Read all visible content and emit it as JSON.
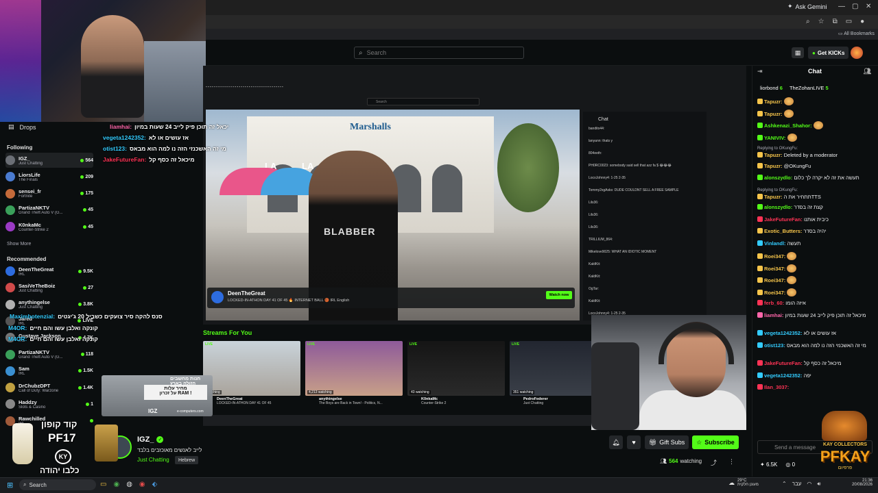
{
  "browser": {
    "ask_gemini": "Ask Gemini",
    "all_bookmarks": "All Bookmarks"
  },
  "header": {
    "search_placeholder": "Search",
    "get_kicks": "Get KICKs"
  },
  "sidebar": {
    "drops": "Drops",
    "following_title": "Following",
    "following": [
      {
        "name": "IGZ_",
        "category": "Just Chatting",
        "viewers": "564",
        "color": "#6b6f76"
      },
      {
        "name": "LiorsLife",
        "category": "The Finals",
        "viewers": "209",
        "color": "#4a7bd0"
      },
      {
        "name": "sensei_fr",
        "category": "Fortnite",
        "viewers": "175",
        "color": "#c46a3a"
      },
      {
        "name": "PartizaNKTV",
        "category": "Grand Theft Auto V (G...",
        "viewers": "45",
        "color": "#3aa05a"
      },
      {
        "name": "K0nkaMc",
        "category": "Counter-Strike 2",
        "viewers": "45",
        "color": "#9a3ac4"
      }
    ],
    "show_more": "Show More",
    "recommended_title": "Recommended",
    "recommended": [
      {
        "name": "DeenTheGreat",
        "category": "IRL",
        "viewers": "9.5K",
        "color": "#2d6cdf"
      },
      {
        "name": "SasiVeTheBoiz",
        "category": "Just Chatting",
        "viewers": "27",
        "color": "#d04a4a"
      },
      {
        "name": "anythingelse",
        "category": "Just Chatting",
        "viewers": "3.8K",
        "color": "#b0b0b0"
      },
      {
        "name": "Jared",
        "category": "IRL",
        "viewers": "LIVE",
        "color": "#555"
      },
      {
        "name": "Gustave Jackson",
        "category": "IRL",
        "viewers": "4.7K",
        "color": "#777"
      },
      {
        "name": "PartizaNKTV",
        "category": "Grand Theft Auto V (G...",
        "viewers": "118",
        "color": "#3aa05a"
      },
      {
        "name": "Sam",
        "category": "IRL",
        "viewers": "1.5K",
        "color": "#3a8fd0"
      },
      {
        "name": "DrChubzDPT",
        "category": "Call of Duty: Warzone",
        "viewers": "1.4K",
        "color": "#c0a040"
      },
      {
        "name": "Haddzy",
        "category": "Slots & Casino",
        "viewers": "1",
        "color": "#888"
      },
      {
        "name": "Rawchilled",
        "category": "IRL",
        "viewers": "",
        "color": "#a05a3a"
      }
    ]
  },
  "overlay_chat": [
    {
      "user": "liamhai:",
      "text": "יכאל זה תוכן פיק לייב 24 שעות במיון",
      "color": "#ff66aa"
    },
    {
      "user": "vegeta1242352:",
      "text": "אז עושים או לא",
      "color": "#33ccff"
    },
    {
      "user": "otist123:",
      "text": "מי זה האשכנזי הזה נו למה הוא מבאס",
      "color": "#33ccff"
    },
    {
      "user": "JakeFutureFan:",
      "text": "מיכאל זה כסף קל",
      "color": "#ff3355"
    },
    {
      "user": "Maximbotenzial:",
      "text": "סנס להקה סיר צועקים כשביל 20 ג'יגטים",
      "color": "#33ccff"
    },
    {
      "user": "M4OR:",
      "text": "קונקה ואלבן עשו והם חיים",
      "color": "#33ccff"
    },
    {
      "user": "M4OR:",
      "text": "קונקה ואלבן עשו והם חיים",
      "color": "#33ccff"
    }
  ],
  "stream": {
    "shop_sign": "Marshalls",
    "la_text": "LA",
    "shirt_text": "BLABBER",
    "promo_name": "DeenTheGreat",
    "promo_desc": "LOCKED-IN-ATHON DAY 41 OF 45 🔥 INTERNET BALL 🏀  IRL  English",
    "watch_now": "Watch now",
    "nested_search": "Search",
    "nested_chat_title": "Chat",
    "nested_chat": [
      "bandito44: ",
      "lanyann: thats y",
      "804eeth: ",
      "PH0RC0023: somebody said sell that azz fa $ 😂😂😂",
      "LocoJohnny4: 1-25 2-35",
      "Tommy2xgAsks: DUDE COULDNT SELL A FREE SAMPLE",
      "Lils36: ",
      "Lils36: ",
      "Lils36: ",
      "TRILLIUM_864: ",
      "Mikelove9025: WHAT AN IDIOTIC MOMENT",
      "KaldKit: ",
      "KaldKit: ",
      "OgTar: ",
      "KaldKit: ",
      "LocoJohnny4: 1-25 2-35"
    ]
  },
  "streams_for_you": {
    "title": "Streams For You",
    "items": [
      {
        "live": "LIVE",
        "watching": "watching",
        "name": "DeenTheGreat",
        "desc": "LOCKED-IN-ATHON DAY 41 OF 45",
        "bg": "linear-gradient(#c9d3da,#a9a39b)"
      },
      {
        "live": "LIVE",
        "watching": "4,213 watching",
        "name": "anythingelse",
        "desc": "The Boys are Back in Town! - Politics, N...",
        "bg": "linear-gradient(#8e5a9a,#c8a088)"
      },
      {
        "live": "LIVE",
        "watching": "43 watching",
        "name": "K0nkaMc",
        "desc": "Counter-Strike 2",
        "bg": "linear-gradient(#151515,#2a2a2a)"
      },
      {
        "live": "LIVE",
        "watching": "351 watching",
        "name": "PedroFederer",
        "desc": "Just Chatting",
        "bg": "linear-gradient(#222630,#3a3f48)"
      }
    ]
  },
  "promo_card": {
    "title": "חנות מחשבים הזולה בארץ",
    "line1": "מחיר עלות",
    "line2": "על זכרון RAM !",
    "site": "e-computers.com",
    "code": "IGZ"
  },
  "code_overlay": {
    "line1": "קוד קופון",
    "line2": "PF17",
    "ky": "KY",
    "line3": "כלבו יהודה"
  },
  "channel": {
    "name": "IGZ_",
    "title": "לייב לאנשים מאוכזבים בלבד",
    "category": "Just Chatting",
    "tag": "Hebrew",
    "gift_subs": "Gift Subs",
    "subscribe": "Subscribe",
    "watching": "564",
    "watching_label": "watching"
  },
  "chat": {
    "title": "Chat",
    "pinned": [
      {
        "name": "liorbond",
        "count": "6"
      },
      {
        "name": "TheZohanLIVE",
        "count": "5"
      }
    ],
    "messages": [
      {
        "reply": "",
        "user": "Tapuzr:",
        "color": "#f6c54b",
        "text": "",
        "emote": true
      },
      {
        "reply": "",
        "user": "Tapuzr:",
        "color": "#f6c54b",
        "text": "",
        "emote": true
      },
      {
        "reply": "",
        "user": "Ashkenazi_Shahor:",
        "color": "#53fc18",
        "text": "",
        "emote": true
      },
      {
        "reply": "",
        "user": "YANIVIV:",
        "color": "#53fc18",
        "text": "",
        "emote": true
      },
      {
        "reply": "Replying to OKungFu:",
        "user": "Tapuzr:",
        "color": "#f6c54b",
        "text": "Deleted by a moderator",
        "emote": false
      },
      {
        "reply": "",
        "user": "Tapuzr:",
        "color": "#f6c54b",
        "text": "@OKungFu",
        "emote": false
      },
      {
        "reply": "",
        "user": "alonszydlo:",
        "color": "#53fc18",
        "text": "תעשה את זה לא יקרה לך כלום",
        "emote": false
      },
      {
        "reply": "Replying to OKungFu:",
        "user": "Tapuzr:",
        "color": "#f6c54b",
        "text": "תתחיר את הTTS",
        "emote": false
      },
      {
        "reply": "",
        "user": "alonszydlo:",
        "color": "#53fc18",
        "text": "קצת זה בסדר",
        "emote": false
      },
      {
        "reply": "",
        "user": "JakeFutureFan:",
        "color": "#ff3355",
        "text": "כיבית אותנו",
        "emote": false
      },
      {
        "reply": "",
        "user": "Exotic_Butters:",
        "color": "#f6c54b",
        "text": "יהיה בסדר",
        "emote": false
      },
      {
        "reply": "",
        "user": "Vinlandl:",
        "color": "#33ccff",
        "text": "תעשה",
        "emote": false
      },
      {
        "reply": "",
        "user": "Roei347:",
        "color": "#f6c54b",
        "text": "",
        "emote": true
      },
      {
        "reply": "",
        "user": "Roei347:",
        "color": "#f6c54b",
        "text": "",
        "emote": true
      },
      {
        "reply": "",
        "user": "Roei347:",
        "color": "#f6c54b",
        "text": "",
        "emote": true
      },
      {
        "reply": "",
        "user": "Roei347:",
        "color": "#f6c54b",
        "text": "",
        "emote": true
      },
      {
        "reply": "",
        "user": "ferb_60:",
        "color": "#ff3355",
        "text": "איזה הומו",
        "emote": false
      },
      {
        "reply": "",
        "user": "liamhai:",
        "color": "#ff66aa",
        "text": "מיכאל זה תוכן פיק לייב 24 שעות במיון",
        "emote": false
      },
      {
        "reply": "",
        "user": "vegeta1242352:",
        "color": "#33ccff",
        "text": "אז עושים או לא",
        "emote": false
      },
      {
        "reply": "",
        "user": "otist123:",
        "color": "#33ccff",
        "text": "מי זה האשכנזי הזה נו למה הוא מבאס",
        "emote": false
      },
      {
        "reply": "",
        "user": "JakeFutureFan:",
        "color": "#ff3355",
        "text": "מיכאל זה כסף קל",
        "emote": false
      },
      {
        "reply": "",
        "user": "vegeta1242352:",
        "color": "#33ccff",
        "text": "יפה",
        "emote": false
      },
      {
        "reply": "",
        "user": "Ilan_3037:",
        "color": "#ff3355",
        "text": "",
        "emote": false
      }
    ],
    "input_placeholder": "Send a message",
    "kicks": "6.5K",
    "zero": "0"
  },
  "pfkay": {
    "line1": "KAY COLLECTORS",
    "line2": "PFKAY",
    "line3": "פרפיום"
  },
  "taskbar": {
    "search": "Search",
    "temp": "29°C",
    "weather": "מעונן חלקית",
    "lang": "עבר",
    "time": "21:36",
    "date": "20/08/2026"
  }
}
